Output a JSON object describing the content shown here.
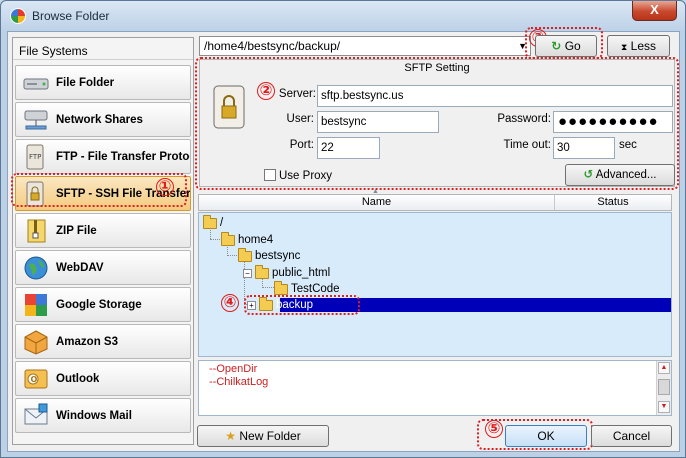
{
  "window": {
    "title": "Browse Folder",
    "close_glyph": "X"
  },
  "left_panel": {
    "header": "File Systems",
    "items": [
      {
        "label": "File Folder",
        "icon": "drive-icon"
      },
      {
        "label": "Network Shares",
        "icon": "network-drive-icon"
      },
      {
        "label": "FTP - File Transfer Protoc",
        "icon": "ftp-server-icon"
      },
      {
        "label": "SFTP - SSH File Transfer",
        "icon": "sftp-server-icon"
      },
      {
        "label": "ZIP File",
        "icon": "zip-file-icon"
      },
      {
        "label": "WebDAV",
        "icon": "globe-icon"
      },
      {
        "label": "Google Storage",
        "icon": "google-icon"
      },
      {
        "label": "Amazon S3",
        "icon": "amazon-box-icon"
      },
      {
        "label": "Outlook",
        "icon": "outlook-icon"
      },
      {
        "label": "Windows Mail",
        "icon": "windows-mail-icon"
      }
    ],
    "selected_index": 3
  },
  "path": {
    "value": "/home4/bestsync/backup/"
  },
  "buttons": {
    "go": "Go",
    "less": "Less",
    "advanced": "Advanced...",
    "new_folder": "New Folder",
    "ok": "OK",
    "cancel": "Cancel"
  },
  "sftp": {
    "group_title": "SFTP Setting",
    "server_label": "Server:",
    "server_value": "sftp.bestsync.us",
    "user_label": "User:",
    "user_value": "bestsync",
    "password_label": "Password:",
    "password_value": "●●●●●●●●●●",
    "port_label": "Port:",
    "port_value": "22",
    "timeout_label": "Time out:",
    "timeout_value": "30",
    "timeout_unit": "sec",
    "use_proxy_label": "Use Proxy",
    "use_proxy_checked": false
  },
  "tree": {
    "columns": {
      "name": "Name",
      "status": "Status"
    },
    "nodes": [
      {
        "label": "/"
      },
      {
        "label": "home4"
      },
      {
        "label": "bestsync"
      },
      {
        "label": "public_html"
      },
      {
        "label": "TestCode"
      },
      {
        "label": "backup"
      }
    ],
    "selected": "backup"
  },
  "log": {
    "lines": [
      "--OpenDir",
      "--ChilkatLog"
    ]
  },
  "callouts": [
    "①",
    "②",
    "③",
    "④",
    "⑤"
  ]
}
